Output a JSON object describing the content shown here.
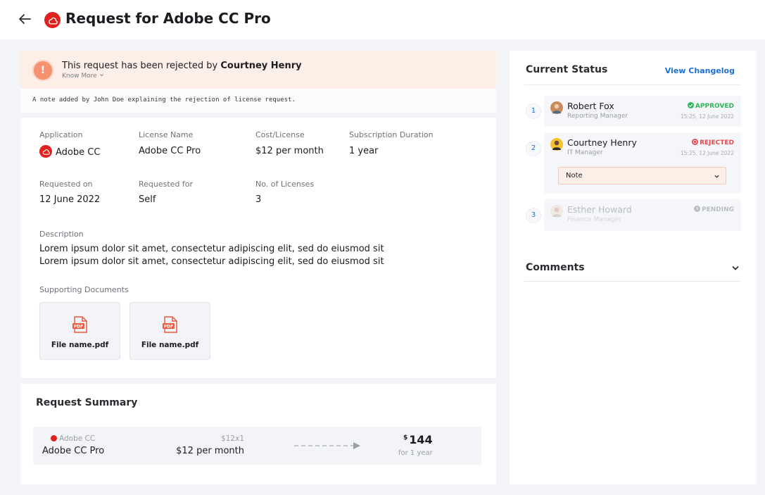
{
  "header": {
    "title": "Request for Adobe CC Pro"
  },
  "alert": {
    "message_prefix": "This request has been rejected by ",
    "rejected_by": "Courtney Henry",
    "know_more": "Know More"
  },
  "note": {
    "text": "A note added by John Doe explaining the rejection of license request."
  },
  "details": {
    "application_label": "Application",
    "application_value": "Adobe CC",
    "license_name_label": "License Name",
    "license_name_value": "Adobe CC Pro",
    "cost_label": "Cost/License",
    "cost_value": "$12 per month",
    "duration_label": "Subscription Duration",
    "duration_value": "1 year",
    "requested_on_label": "Requested on",
    "requested_on_value": "12 June 2022",
    "requested_for_label": "Requested for",
    "requested_for_value": "Self",
    "licenses_label": "No. of Licenses",
    "licenses_value": "3",
    "description_label": "Description",
    "description_value": "Lorem ipsum dolor sit amet, consectetur adipiscing elit, sed do eiusmod sit Lorem ipsum dolor sit amet, consectetur adipiscing elit, sed do eiusmod sit",
    "documents_label": "Supporting Documents",
    "documents": [
      {
        "name": "File name.pdf",
        "icon": "pdf-file-icon"
      },
      {
        "name": "File name.pdf",
        "icon": "pdf-file-icon"
      }
    ],
    "pdf_badge": "PDF"
  },
  "summary": {
    "title": "Request Summary",
    "app": "Adobe CC",
    "license": "Adobe CC Pro",
    "multiplier": "$12x1",
    "cost": "$12 per month",
    "currency": "$",
    "total": "144",
    "period": "for 1 year"
  },
  "status": {
    "title": "Current Status",
    "changelog_label": "View Changelog",
    "approvers": [
      {
        "step": "1",
        "name": "Robert Fox",
        "role": "Reporting Manager",
        "status": "APPROVED",
        "time": "15:25, 12 June 2022",
        "color": "#2fb55b"
      },
      {
        "step": "2",
        "name": "Courtney Henry",
        "role": "IT Manager",
        "status": "REJECTED",
        "time": "15:25, 12 June 2022",
        "color": "#e5484d",
        "note_label": "Note"
      },
      {
        "step": "3",
        "name": "Esther Howard",
        "role": "Finance Manager",
        "status": "PENDING",
        "color": "#b9bcc2"
      }
    ]
  },
  "comments": {
    "title": "Comments"
  },
  "colors": {
    "brand_red": "#e0211f",
    "accent_blue": "#1f6fd1",
    "alert_bg": "#fdeee8",
    "alert_icon": "#f4926f"
  }
}
